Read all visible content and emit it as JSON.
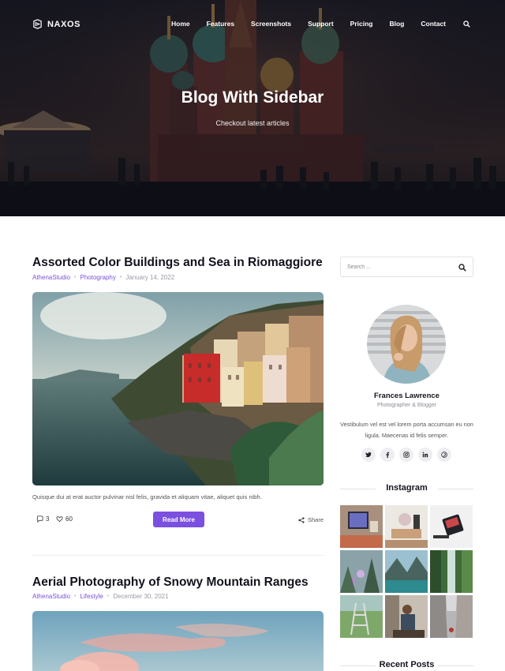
{
  "brand": {
    "name": "NAXOS"
  },
  "nav": {
    "items": [
      "Home",
      "Features",
      "Screenshots",
      "Support",
      "Pricing",
      "Blog",
      "Contact"
    ],
    "search_icon": "search-icon"
  },
  "hero": {
    "title": "Blog With Sidebar",
    "subtitle": "Checkout latest articles"
  },
  "posts": [
    {
      "title": "Assorted Color Buildings and Sea in Riomaggiore",
      "author": "AthenaStudio",
      "category": "Photography",
      "date": "January 14, 2022",
      "excerpt": "Quisque dui at erat auctor pulvinar nisl felis, gravida et aliquam vitae, aliquet quis nibh.",
      "comments": "3",
      "likes": "60",
      "read_more": "Read More",
      "share": "Share"
    },
    {
      "title": "Aerial Photography of Snowy Mountain Ranges",
      "author": "AthenaStudio",
      "category": "Lifestyle",
      "date": "December 30, 2021"
    }
  ],
  "sidebar": {
    "search_placeholder": "Search ...",
    "author": {
      "name": "Frances Lawrence",
      "role": "Photographer & Blogger",
      "bio": "Vestibulum vel est vel lorem porta accumsan eu non ligula. Maecenas id felis semper."
    },
    "socials": [
      "twitter-icon",
      "facebook-icon",
      "instagram-icon",
      "linkedin-icon",
      "pinterest-icon"
    ],
    "instagram_title": "Instagram",
    "recent_posts_title": "Recent Posts"
  },
  "colors": {
    "accent": "#7b4fe0",
    "link": "#7a52d8"
  }
}
